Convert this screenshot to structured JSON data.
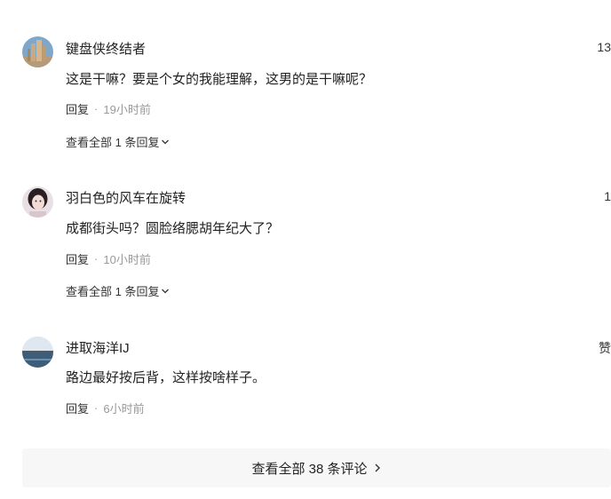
{
  "comments": [
    {
      "username": "键盘侠终结者",
      "likes": "13",
      "text": "这是干嘛？要是个女的我能理解，这男的是干嘛呢？",
      "reply_label": "回复",
      "time": "19小时前",
      "view_replies": "查看全部 1 条回复"
    },
    {
      "username": "羽白色的风车在旋转",
      "likes": "1",
      "text": "成都街头吗？圆脸络腮胡年纪大了？",
      "reply_label": "回复",
      "time": "10小时前",
      "view_replies": "查看全部 1 条回复"
    },
    {
      "username": "进取海洋IJ",
      "likes": "赞",
      "text": "路边最好按后背，这样按啥样子。",
      "reply_label": "回复",
      "time": "6小时前"
    }
  ],
  "separator": "·",
  "view_all_label": "查看全部 38 条评论",
  "icons": {
    "chevron": "chevron-down-icon",
    "arrow": "chevron-right-icon"
  }
}
